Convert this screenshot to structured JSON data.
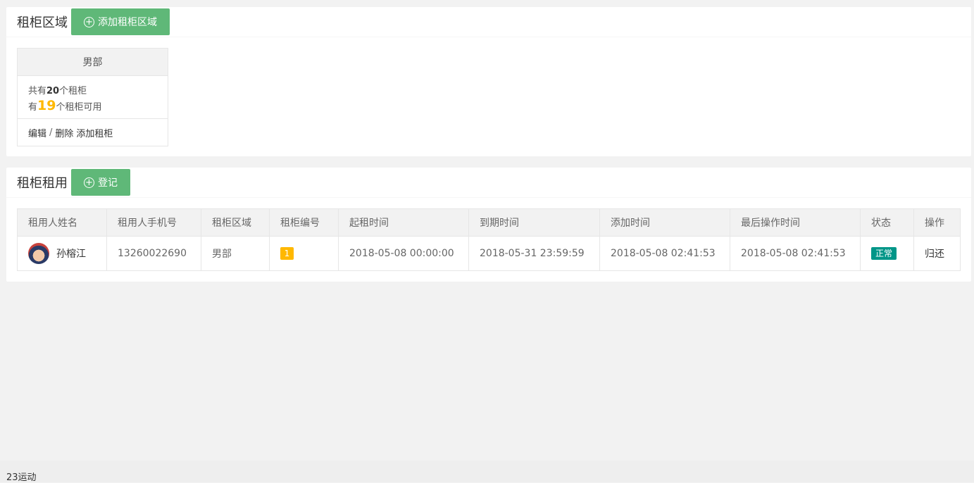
{
  "areas_section": {
    "title": "租柜区域",
    "add_button": "添加租柜区域",
    "area": {
      "name": "男部",
      "total_prefix": "共有",
      "total_count": "20",
      "total_suffix": "个租柜",
      "avail_prefix": "有",
      "avail_count": "19",
      "avail_suffix": "个租柜可用",
      "edit": "编辑",
      "sep": "/",
      "delete": "删除",
      "add_locker": "添加租柜"
    }
  },
  "rental_section": {
    "title": "租柜租用",
    "register_button": "登记",
    "columns": [
      "租用人姓名",
      "租用人手机号",
      "租柜区域",
      "租柜编号",
      "起租时间",
      "到期时间",
      "添加时间",
      "最后操作时间",
      "状态",
      "操作"
    ],
    "rows": [
      {
        "name": "孙榕江",
        "phone": "13260022690",
        "area": "男部",
        "number": "1",
        "start": "2018-05-08 00:00:00",
        "end": "2018-05-31 23:59:59",
        "added": "2018-05-08 02:41:53",
        "last_op": "2018-05-08 02:41:53",
        "status": "正常",
        "action": "归还"
      }
    ]
  },
  "colors": {
    "green": "#5fb878",
    "amber": "#ffb800",
    "teal": "#009688"
  },
  "footer": {
    "text": "23运动"
  }
}
